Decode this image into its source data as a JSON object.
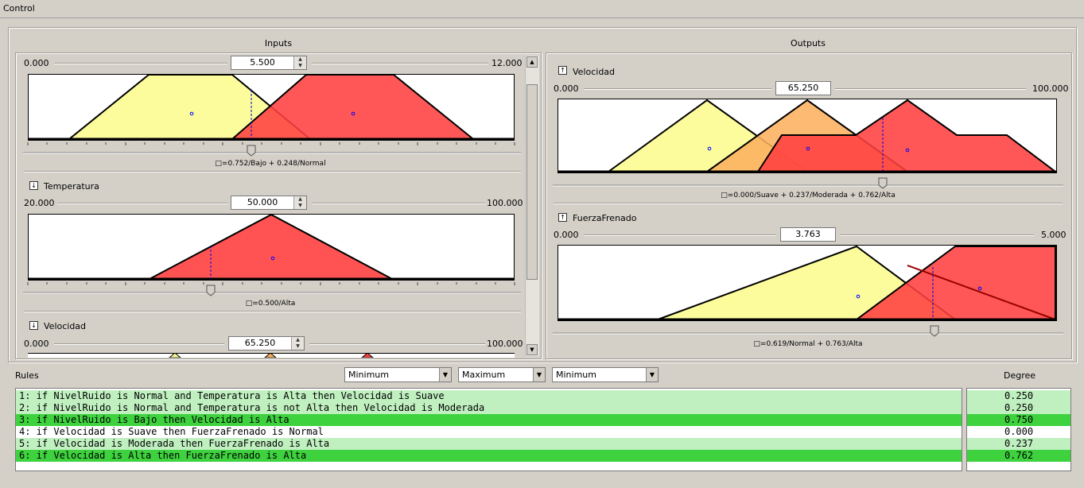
{
  "window": {
    "title": "Control"
  },
  "inputs": {
    "title": "Inputs",
    "variables": [
      {
        "name": "",
        "min": "0.000",
        "max": "12.000",
        "value": "5.500",
        "degree": "□=0.752/Bajo + 0.248/Normal"
      },
      {
        "name": "Temperatura",
        "min": "20.000",
        "max": "100.000",
        "value": "50.000",
        "degree": "□=0.500/Alta"
      },
      {
        "name": "Velocidad",
        "min": "0.000",
        "max": "100.000",
        "value": "65.250",
        "degree": ""
      }
    ]
  },
  "outputs": {
    "title": "Outputs",
    "variables": [
      {
        "name": "Velocidad",
        "min": "0.000",
        "max": "100.000",
        "value": "65.250",
        "degree": "□=0.000/Suave + 0.237/Moderada + 0.762/Alta"
      },
      {
        "name": "FuerzaFrenado",
        "min": "0.000",
        "max": "5.000",
        "value": "3.763",
        "degree": "□=0.619/Normal + 0.763/Alta"
      }
    ]
  },
  "rules": {
    "label": "Rules",
    "degree_label": "Degree",
    "operators": [
      "Minimum",
      "Maximum",
      "Minimum"
    ],
    "items": [
      {
        "text": "1: if NivelRuido is Normal and Temperatura is Alta then Velocidad is Suave",
        "degree": "0.250",
        "shade": "light"
      },
      {
        "text": "2: if NivelRuido is Normal and Temperatura is not Alta then Velocidad is Moderada",
        "degree": "0.250",
        "shade": "light"
      },
      {
        "text": "3: if NivelRuido is Bajo then Velocidad is Alta",
        "degree": "0.750",
        "shade": "dark"
      },
      {
        "text": "4: if Velocidad is Suave then FuerzaFrenado is Normal",
        "degree": "0.000",
        "shade": "white"
      },
      {
        "text": "5: if Velocidad is Moderada then FuerzaFrenado is Alta",
        "degree": "0.237",
        "shade": "light"
      },
      {
        "text": "6: if Velocidad is Alta then FuerzaFrenado is Alta",
        "degree": "0.762",
        "shade": "dark"
      }
    ]
  },
  "colors": {
    "yellow": "#fcfc9c",
    "red": "#ff4040",
    "orange": "#fcb060",
    "rule_light": "#c0f0c0",
    "rule_dark": "#3fd23f"
  },
  "icons": {
    "variable": "export-icon",
    "spin": "spinner-arrows-icon",
    "scroll": "scroll-arrow-icon",
    "combo": "dropdown-arrow-icon"
  }
}
